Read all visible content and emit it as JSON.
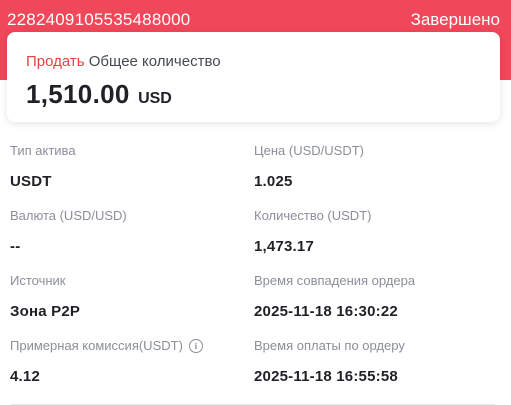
{
  "header": {
    "order_id": "2282409105535488000",
    "status": "Завершено"
  },
  "summary": {
    "side": "Продать",
    "total_label": "Общее количество",
    "amount": "1,510.00",
    "currency": "USD"
  },
  "fields": {
    "asset_type": {
      "label": "Тип актива",
      "value": "USDT"
    },
    "price": {
      "label": "Цена (USD/USDT)",
      "value": "1.025"
    },
    "fiat_currency": {
      "label": "Валюта (USD/USD)",
      "value": "--"
    },
    "quantity": {
      "label": "Количество (USDT)",
      "value": "1,473.17"
    },
    "source": {
      "label": "Источник",
      "value": "Зона P2P"
    },
    "match_time": {
      "label": "Время совпадения ордера",
      "value": "2025-11-18 16:30:22"
    },
    "fee": {
      "label": "Примерная комиссия(USDT)",
      "value": "4.12",
      "icon": "info-icon"
    },
    "payment_time": {
      "label": "Время оплаты по ордеру",
      "value": "2025-11-18 16:55:58"
    }
  },
  "colors": {
    "header_bg": "#f0475a",
    "sell_red": "#e8433f",
    "label_gray": "#8a8f98"
  }
}
